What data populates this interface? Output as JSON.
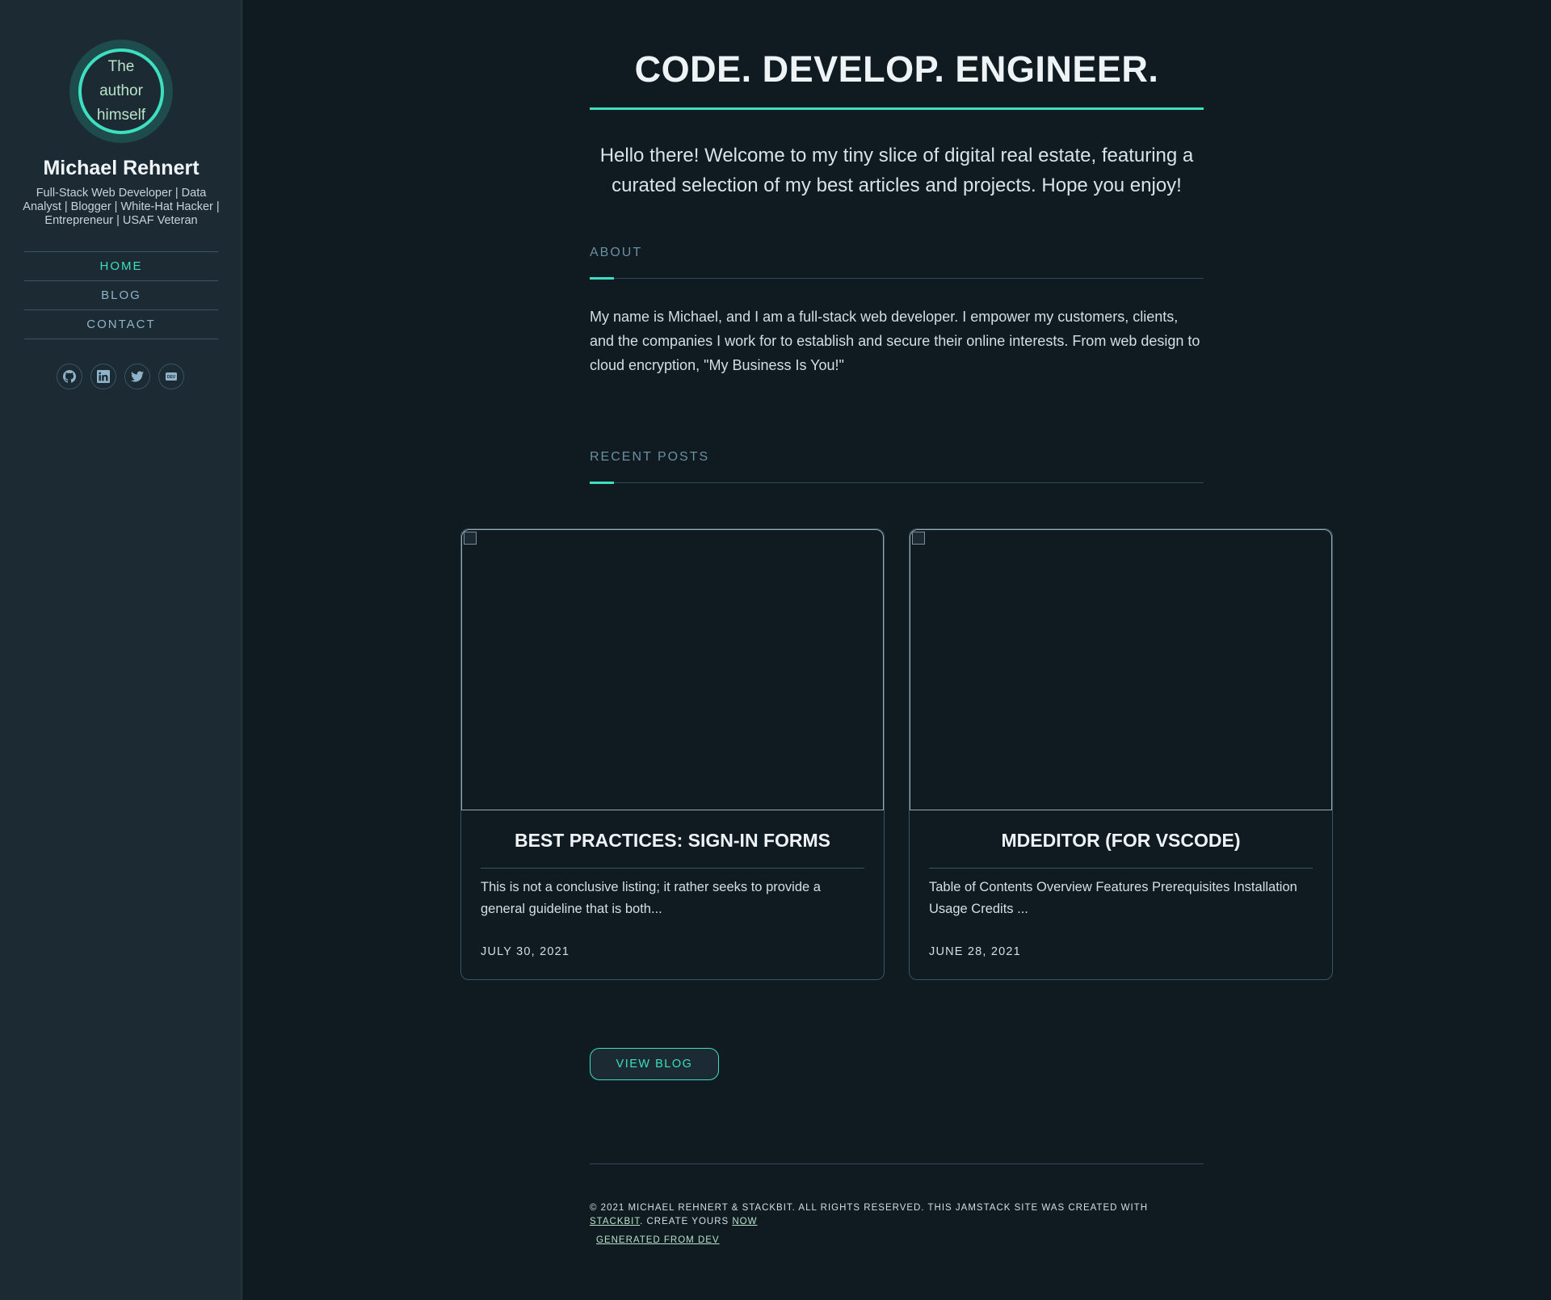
{
  "sidebar": {
    "avatar_alt": "The author himself",
    "name": "Michael Rehnert",
    "tagline": "Full-Stack Web Developer | Data Analyst | Blogger | White-Hat Hacker | Entrepreneur | USAF Veteran",
    "nav": [
      {
        "label": "HOME",
        "active": true
      },
      {
        "label": "BLOG",
        "active": false
      },
      {
        "label": "CONTACT",
        "active": false
      }
    ],
    "social_icons": [
      "github-icon",
      "linkedin-icon",
      "twitter-icon",
      "dev-icon"
    ]
  },
  "header": {
    "title": "CODE. DEVELOP. ENGINEER.",
    "intro": "Hello there! Welcome to my tiny slice of digital real estate, featuring a curated selection of my best articles and projects. Hope you enjoy!"
  },
  "about": {
    "label": "ABOUT",
    "text": "My name is Michael, and I am a full-stack web developer. I empower my customers, clients, and the companies I work for to establish and secure their online interests. From web design to cloud encryption, \"My Business Is You!\""
  },
  "recent_posts": {
    "label": "RECENT POSTS",
    "posts": [
      {
        "title": "BEST PRACTICES: SIGN-IN FORMS",
        "excerpt": "This is not a conclusive listing; it rather seeks to provide a general guideline that is both...",
        "date": "JULY 30, 2021"
      },
      {
        "title": "MDEDITOR (FOR VSCODE)",
        "excerpt": "Table of Contents Overview Features Prerequisites Installation Usage Credits ...",
        "date": "JUNE 28, 2021"
      }
    ],
    "view_blog_label": "VIEW BLOG"
  },
  "footer": {
    "copyright": "© 2021 MICHAEL REHNERT & STACKBIT. ALL RIGHTS RESERVED. THIS JAMSTACK SITE WAS CREATED WITH ",
    "stackbit_link": "STACKBIT",
    "create_text": ". CREATE YOURS ",
    "now_link": "NOW",
    "generated_link": "GENERATED FROM DEV"
  },
  "colors": {
    "accent": "#3ddfc0",
    "background": "#101a21",
    "sidebar": "#1b2a33"
  }
}
